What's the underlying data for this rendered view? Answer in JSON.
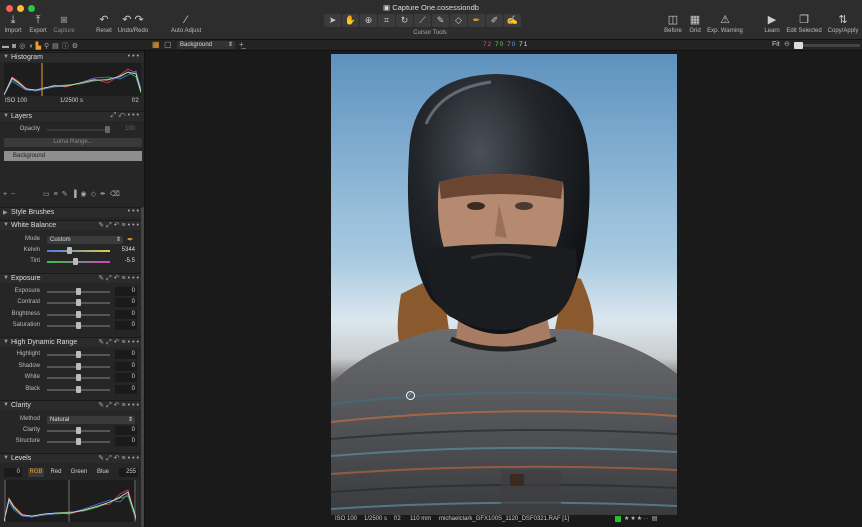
{
  "window": {
    "title": "Capture One.cosessiondb"
  },
  "toolbar_left": [
    {
      "label": "Import",
      "icon": "import-icon"
    },
    {
      "label": "Export",
      "icon": "export-icon"
    },
    {
      "label": "Capture",
      "icon": "camera-icon"
    },
    {
      "label": "Reset",
      "icon": "reset-icon"
    },
    {
      "label": "Undo/Redo",
      "icon": "undo-redo-icon"
    },
    {
      "label": "Auto Adjust",
      "icon": "magic-wand-icon"
    }
  ],
  "cursor_tools": {
    "label": "Cursor Tools"
  },
  "toolbar_right": [
    {
      "label": "Before",
      "icon": "before-icon"
    },
    {
      "label": "Grid",
      "icon": "grid-icon"
    },
    {
      "label": "Exp. Warning",
      "icon": "exposure-warning-icon"
    },
    {
      "label": "Learn",
      "icon": "learn-icon"
    },
    {
      "label": "Edit Selected",
      "icon": "edit-selected-icon"
    },
    {
      "label": "Copy/Apply",
      "icon": "copy-apply-icon"
    }
  ],
  "viewer_bar": {
    "layer_select": "Background",
    "rgb_readout": {
      "r": "72",
      "g": "70",
      "b": "70",
      "l": "71"
    },
    "zoom": "Fit"
  },
  "histogram": {
    "title": "Histogram",
    "iso": "ISO 100",
    "shutter": "1/2500 s",
    "aperture": "f/2"
  },
  "layers": {
    "title": "Layers",
    "opacity_label": "Opacity",
    "opacity_value": "100",
    "luma_button": "Luma Range...",
    "layer_name": "Background"
  },
  "style_brushes": {
    "title": "Style Brushes"
  },
  "white_balance": {
    "title": "White Balance",
    "mode_label": "Mode",
    "mode_value": "Custom",
    "kelvin_label": "Kelvin",
    "kelvin_value": "5344",
    "tint_label": "Tint",
    "tint_value": "-5.5"
  },
  "exposure": {
    "title": "Exposure",
    "rows": [
      {
        "label": "Exposure",
        "value": "0"
      },
      {
        "label": "Contrast",
        "value": "0"
      },
      {
        "label": "Brightness",
        "value": "0"
      },
      {
        "label": "Saturation",
        "value": "0"
      }
    ]
  },
  "hdr": {
    "title": "High Dynamic Range",
    "rows": [
      {
        "label": "Highlight",
        "value": "0"
      },
      {
        "label": "Shadow",
        "value": "0"
      },
      {
        "label": "White",
        "value": "0"
      },
      {
        "label": "Black",
        "value": "0"
      }
    ]
  },
  "clarity": {
    "title": "Clarity",
    "method_label": "Method",
    "method_value": "Natural",
    "rows": [
      {
        "label": "Clarity",
        "value": "0"
      },
      {
        "label": "Structure",
        "value": "0"
      }
    ]
  },
  "levels": {
    "title": "Levels",
    "low": "0",
    "high": "255",
    "channels": [
      "RGB",
      "Red",
      "Green",
      "Blue"
    ]
  },
  "image_info": {
    "iso": "ISO 100",
    "shutter": "1/2500 s",
    "aperture": "f/2",
    "focal": "110 mm",
    "filename": "michaelclark_GFX100S_1120_DSF0321.RAF [1]"
  },
  "colors": {
    "accent": "#f0a030",
    "close": "#fe5f57",
    "minimize": "#febc2e",
    "zoom": "#28c840"
  }
}
